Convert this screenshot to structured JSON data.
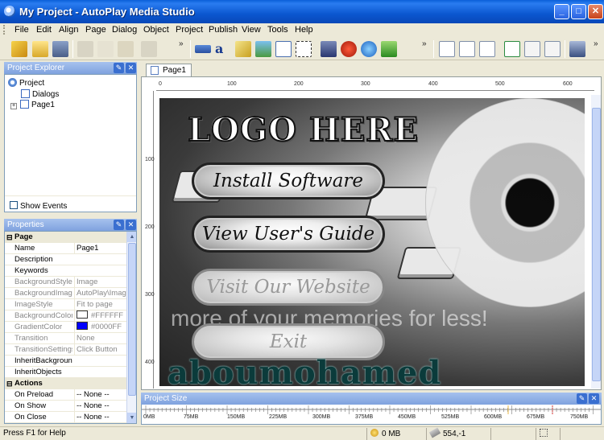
{
  "window": {
    "title": "My Project - AutoPlay Media Studio",
    "controls": {
      "minimize": "_",
      "maximize": "□",
      "close": "✕"
    }
  },
  "menu": [
    "File",
    "Edit",
    "Align",
    "Page",
    "Dialog",
    "Object",
    "Project",
    "Publish",
    "View",
    "Tools",
    "Help"
  ],
  "toolbar": {
    "chevron": "»",
    "icons": [
      "wizard-icon",
      "open-icon",
      "save-icon",
      "cut-icon",
      "copy-icon",
      "paste-icon",
      "undo-icon",
      "button-object-icon",
      "label-object-icon",
      "paragraph-object-icon",
      "image-object-icon",
      "listbox-object-icon",
      "input-object-icon",
      "video-object-icon",
      "flash-object-icon",
      "web-object-icon",
      "media-player-icon",
      "new-page-icon",
      "delete-page-icon",
      "preview-page-icon",
      "new-dialog-icon",
      "dialog-icon",
      "dialog-preview-icon",
      "build-icon"
    ]
  },
  "explorer": {
    "title": "Project Explorer",
    "tree": [
      {
        "label": "Project",
        "level": 0
      },
      {
        "label": "Dialogs",
        "level": 1
      },
      {
        "label": "Page1",
        "level": 1
      }
    ],
    "show_events": "Show Events"
  },
  "properties": {
    "title": "Properties",
    "rows": [
      {
        "type": "cat",
        "key": "Page"
      },
      {
        "key": "Name",
        "value": "Page1"
      },
      {
        "key": "Description",
        "value": ""
      },
      {
        "key": "Keywords",
        "value": ""
      },
      {
        "key": "BackgroundStyle",
        "value": "Image",
        "gray": true
      },
      {
        "key": "BackgroundImage",
        "value": "AutoPlay\\Image",
        "gray": true
      },
      {
        "key": "ImageStyle",
        "value": "Fit to page",
        "gray": true
      },
      {
        "key": "BackgroundColor",
        "value": "#FFFFFF",
        "gray": true,
        "swatch": "#FFFFFF"
      },
      {
        "key": "GradientColor",
        "value": "#0000FF",
        "gray": true,
        "swatch": "#0000FF"
      },
      {
        "key": "Transition",
        "value": "None",
        "gray": true
      },
      {
        "key": "TransitionSettings",
        "value": "Click Button",
        "gray": true
      },
      {
        "key": "InheritBackground",
        "value": ""
      },
      {
        "key": "InheritObjects",
        "value": ""
      },
      {
        "type": "cat",
        "key": "Actions"
      },
      {
        "key": "On Preload",
        "value": "-- None --"
      },
      {
        "key": "On Show",
        "value": "-- None --"
      },
      {
        "key": "On Close",
        "value": "-- None --"
      }
    ]
  },
  "editor": {
    "tab": "Page1",
    "hruler": [
      "0",
      "100",
      "200",
      "300",
      "400",
      "500",
      "600"
    ],
    "vruler": [
      "100",
      "200",
      "300",
      "400"
    ],
    "canvas": {
      "logo": "LOGO HERE",
      "buttons": [
        {
          "label": "Install Software",
          "dim": false
        },
        {
          "label": "View User's Guide",
          "dim": false
        },
        {
          "label": "Visit Our Website",
          "dim": true
        },
        {
          "label": "Exit",
          "dim": true
        }
      ],
      "watermark_text": "more of your memories for less!",
      "brand": "aboumohamed"
    }
  },
  "project_size": {
    "title": "Project Size",
    "ticks": [
      "0MB",
      "75MB",
      "150MB",
      "225MB",
      "300MB",
      "375MB",
      "450MB",
      "525MB",
      "600MB",
      "675MB",
      "750MB"
    ]
  },
  "status": {
    "help": "Press F1 for Help",
    "size": "0 MB",
    "coords": "554,-1"
  },
  "colors": {
    "titlebar": "#0b57d0",
    "panel_title": "#7fa2de",
    "accent": "#316ac5"
  }
}
